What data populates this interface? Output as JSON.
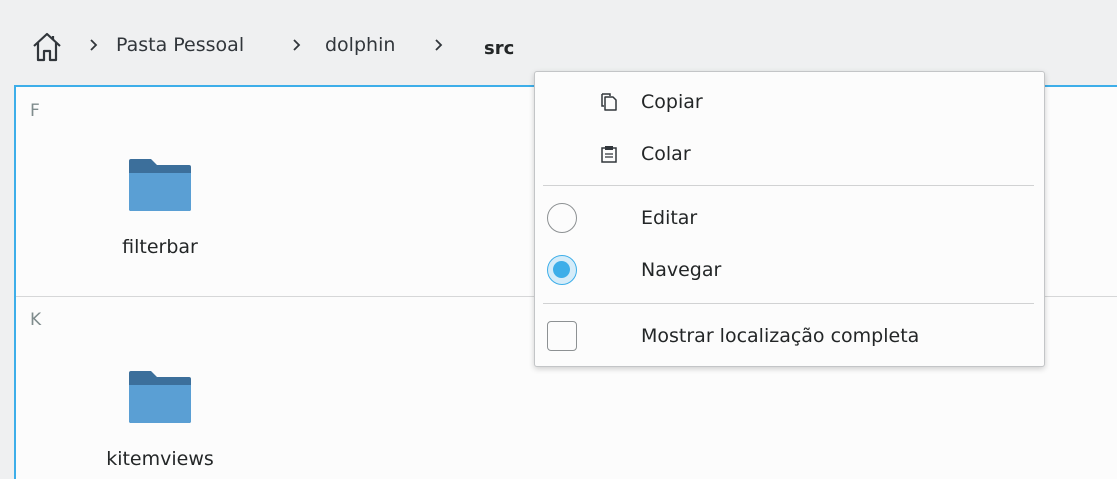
{
  "breadcrumb": {
    "home_icon": "home-icon",
    "separator_icon": "chevron-right-icon",
    "items": [
      {
        "label": "Pasta Pessoal"
      },
      {
        "label": "dolphin"
      }
    ],
    "current": "src"
  },
  "view": {
    "groups": [
      {
        "header": "F",
        "items": [
          {
            "name": "filterbar",
            "icon": "folder-icon"
          }
        ]
      },
      {
        "header": "K",
        "items": [
          {
            "name": "kitemviews",
            "icon": "folder-icon"
          }
        ]
      }
    ]
  },
  "context_menu": {
    "copy": {
      "label": "Copiar",
      "icon": "copy-icon"
    },
    "paste": {
      "label": "Colar",
      "icon": "paste-icon"
    },
    "edit": {
      "label": "Editar",
      "checked": false
    },
    "navigate": {
      "label": "Navegar",
      "checked": true
    },
    "full_path": {
      "label": "Mostrar localização completa",
      "checked": false
    }
  },
  "colors": {
    "accent": "#3daee9",
    "folder": "#5a9fd4"
  }
}
